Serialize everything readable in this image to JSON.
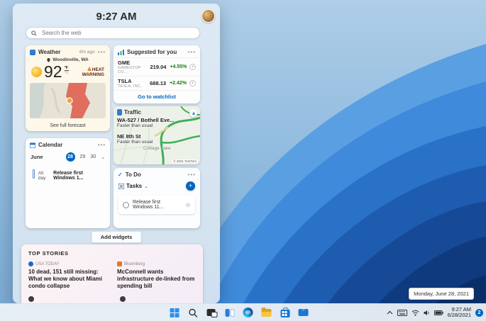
{
  "widgets_panel": {
    "time": "9:27 AM",
    "search_placeholder": "Search the web",
    "weather": {
      "title": "Weather",
      "updated": "6m ago",
      "location": "Woodinville, WA",
      "temperature": "92",
      "unit_primary": "°F",
      "unit_secondary": "°C",
      "alert_line1": "HEAT",
      "alert_line2": "WARNING",
      "footer": "See full forecast"
    },
    "stocks": {
      "title": "Suggested for you",
      "rows": [
        {
          "symbol": "GME",
          "company": "GAMESTOP CO...",
          "price": "219.04",
          "change": "+4.55%"
        },
        {
          "symbol": "TSLA",
          "company": "TESLA, INC.",
          "price": "688.13",
          "change": "+2.42%"
        }
      ],
      "footer_link": "Go to watchlist"
    },
    "traffic": {
      "title": "Traffic",
      "routes": [
        {
          "name": "WA-527 / Bothell Eve...",
          "status": "Faster than usual"
        },
        {
          "name": "NE 8th St",
          "status": "Faster than usual"
        }
      ],
      "map_label": "Cottage Lake",
      "attribution": "© 2021 TomTom"
    },
    "calendar": {
      "title": "Calendar",
      "month": "June",
      "selected_day": "28",
      "other_days": [
        "29",
        "30"
      ],
      "event_time": "All day",
      "event_title": "Release first Windows 1..."
    },
    "todo": {
      "title": "To Do",
      "list_name": "Tasks",
      "task_title": "Release first Windows 11...",
      "add_glyph": "+",
      "star_glyph": "☆"
    },
    "add_widgets": "Add widgets",
    "news": {
      "section_title": "TOP STORIES",
      "stories": [
        {
          "source": "USA TODAY",
          "headline": "10 dead, 151 still missing: What we know about Miami condo collapse"
        },
        {
          "source": "Bloomberg",
          "headline": "McConnell wants infrastructure de-linked from spending bill"
        }
      ]
    },
    "glyphs": {
      "menu": "•••",
      "chevron_down": "⌄"
    }
  },
  "taskbar": {
    "buttons": [
      "Start",
      "Search",
      "Task view",
      "Widgets",
      "Microsoft Edge",
      "File Explorer",
      "Microsoft Store",
      "Mail"
    ],
    "tray_time": "9:27 AM",
    "tray_date": "6/28/2021",
    "notification_count": "2"
  },
  "tooltip": "Monday, June 28, 2021",
  "colors": {
    "accent": "#0067c0",
    "positive": "#107c10"
  }
}
